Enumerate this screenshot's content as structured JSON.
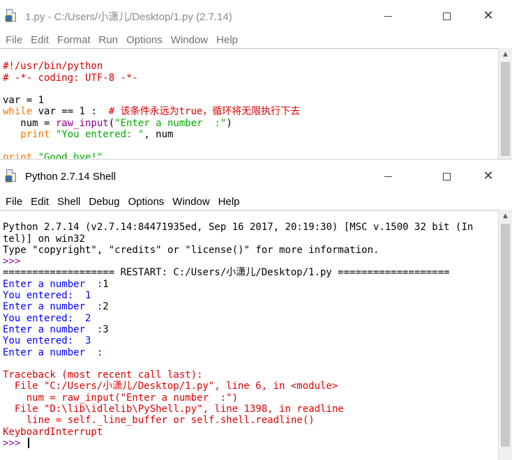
{
  "editor": {
    "title": "1.py - C:/Users/小潇儿/Desktop/1.py (2.7.14)",
    "menu": [
      "File",
      "Edit",
      "Format",
      "Run",
      "Options",
      "Window",
      "Help"
    ],
    "code": {
      "shebang": "#!/usr/bin/python",
      "coding": "# -*- coding: UTF-8 -*-",
      "assign": "var = 1",
      "while_kw": "while",
      "while_cond": " var == 1 :  ",
      "while_comment": "# 该条件永远为true，循环将无限执行下去",
      "num_indent": "   num = ",
      "raw_input": "raw_input",
      "paren_open": "(",
      "prompt_str": "\"Enter a number  :\"",
      "paren_close": ")",
      "print_indent": "   ",
      "print_kw": "print",
      "you_str": " \"You entered: \"",
      "num_tail": ", num",
      "print_kw2": "print",
      "goodbye_str": " \"Good bye!\""
    }
  },
  "shell": {
    "title": "Python 2.7.14 Shell",
    "menu": [
      "File",
      "Edit",
      "Shell",
      "Debug",
      "Options",
      "Window",
      "Help"
    ],
    "output": {
      "banner1": "Python 2.7.14 (v2.7.14:84471935ed, Sep 16 2017, 20:19:30) [MSC v.1500 32 bit (In",
      "banner2": "tel)] on win32",
      "banner3": "Type \"copyright\", \"credits\" or \"license()\" for more information.",
      "prompt": ">>>",
      "restart": "=================== RESTART: C:/Users/小潇儿/Desktop/1.py ===================",
      "run_lines": [
        {
          "text": "Enter a number  :",
          "value": "1"
        },
        {
          "text": "You entered:  1"
        },
        {
          "text": "Enter a number  :",
          "value": "2"
        },
        {
          "text": "You entered:  2"
        },
        {
          "text": "Enter a number  :",
          "value": "3"
        },
        {
          "text": "You entered:  3"
        },
        {
          "text": "Enter a number  :"
        }
      ],
      "traceback": [
        "Traceback (most recent call last):",
        "  File \"C:/Users/小潇儿/Desktop/1.py\", line 6, in <module>",
        "    num = raw_input(\"Enter a number  :\")",
        "  File \"D:\\lib\\idlelib\\PyShell.py\", line 1398, in readline",
        "    line = self._line_buffer or self.shell.readline()",
        "KeyboardInterrupt"
      ],
      "final_prompt": ">>> "
    }
  },
  "colors": {
    "keyword": "#ff7700",
    "comment": "#dd0000",
    "string": "#00aa00",
    "builtin": "#900090",
    "stdout": "#0000ff",
    "stderr": "#dd0000",
    "prompt": "#900090"
  },
  "icons": {
    "app": "idle-python-file-icon",
    "minimize": "minimize-icon",
    "maximize": "maximize-icon",
    "close": "close-icon",
    "scroll_up": "scroll-up-icon"
  }
}
